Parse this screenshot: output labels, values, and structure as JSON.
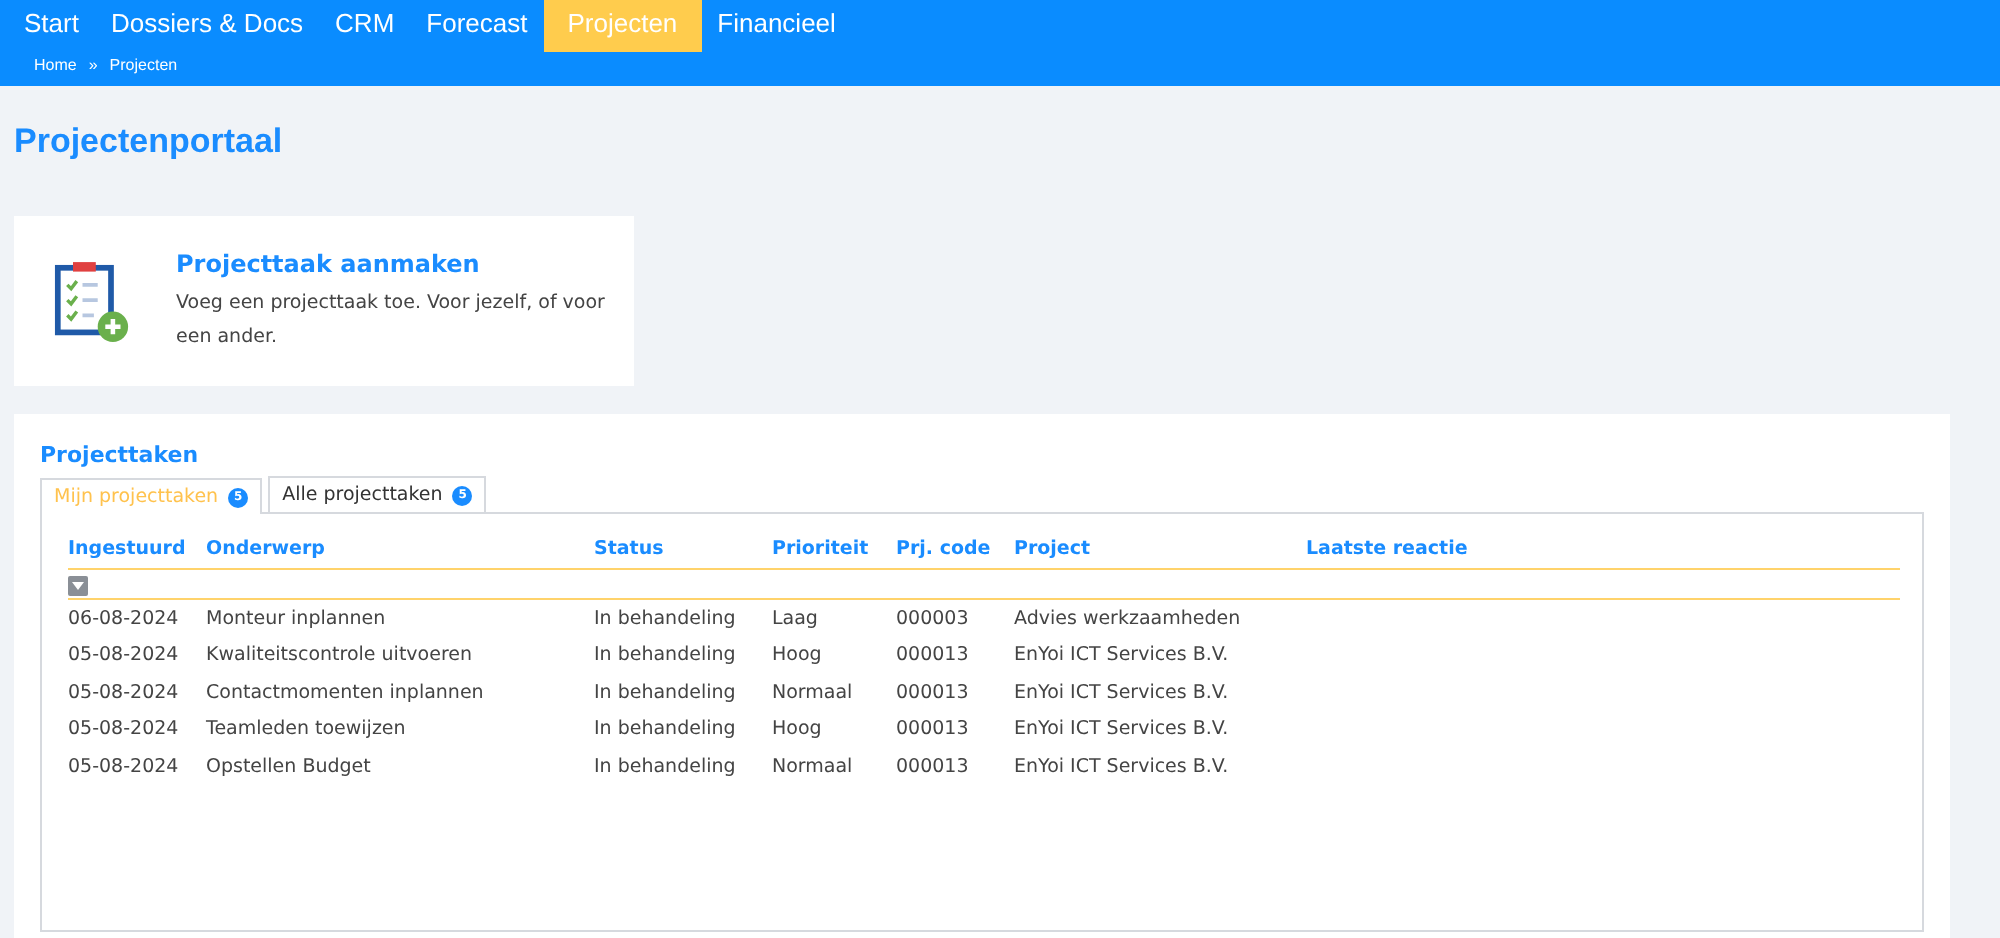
{
  "nav": {
    "items": [
      {
        "label": "Start",
        "selected": false
      },
      {
        "label": "Dossiers & Docs",
        "selected": false
      },
      {
        "label": "CRM",
        "selected": false
      },
      {
        "label": "Forecast",
        "selected": false
      },
      {
        "label": "Projecten",
        "selected": true
      },
      {
        "label": "Financieel",
        "selected": false
      }
    ]
  },
  "breadcrumb": [
    "Home",
    "»",
    "Projecten"
  ],
  "page_title": "Projectenportaal",
  "action_card": {
    "title": "Projecttaak aanmaken",
    "description": "Voeg een projecttaak toe. Voor jezelf, of voor een ander."
  },
  "section": {
    "title": "Projecttaken",
    "tabs": [
      {
        "label": "Mijn projecttaken",
        "count": "5",
        "selected": true
      },
      {
        "label": "Alle projecttaken",
        "count": "5",
        "selected": false
      }
    ],
    "table": {
      "columns": [
        "Ingestuurd",
        "Onderwerp",
        "Status",
        "Prioriteit",
        "Prj. code",
        "Project",
        "Laatste reactie"
      ],
      "rows": [
        [
          "06-08-2024",
          "Monteur inplannen",
          "In behandeling",
          "Laag",
          "000003",
          "Advies werkzaamheden"
        ],
        [
          "05-08-2024",
          "Kwaliteitscontrole uitvoeren",
          "In behandeling",
          "Hoog",
          "000013",
          "EnYoi ICT Services B.V."
        ],
        [
          "05-08-2024",
          "Contactmomenten inplannen",
          "In behandeling",
          "Normaal",
          "000013",
          "EnYoi ICT Services B.V."
        ],
        [
          "05-08-2024",
          "Teamleden toewijzen",
          "In behandeling",
          "Hoog",
          "000013",
          "EnYoi ICT Services B.V."
        ],
        [
          "05-08-2024",
          "Opstellen Budget",
          "In behandeling",
          "Normaal",
          "000013",
          "EnYoi ICT Services B.V."
        ]
      ]
    }
  }
}
